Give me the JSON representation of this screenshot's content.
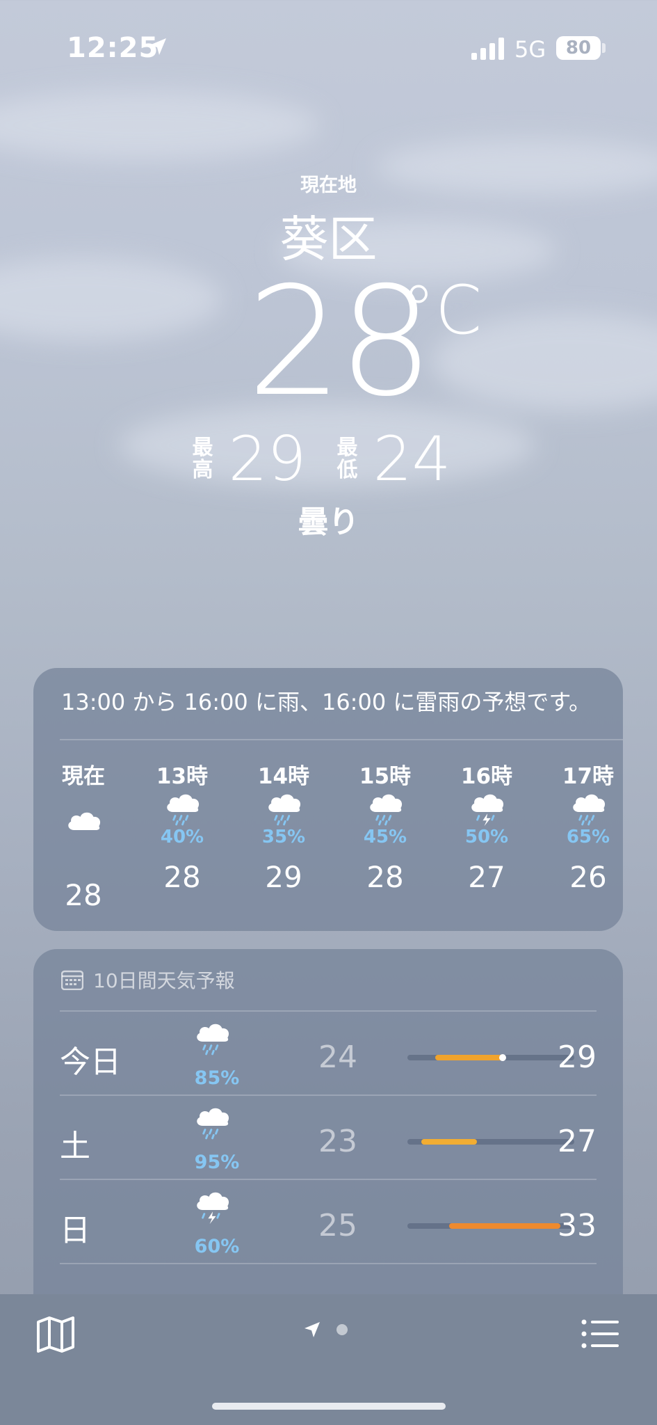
{
  "status_bar": {
    "time": "12:25",
    "network": "5G",
    "battery": "80"
  },
  "header": {
    "location_label": "現在地",
    "city": "葵区",
    "temperature": "28",
    "unit": "°C",
    "high_label": "最高",
    "high": "29",
    "low_label": "最低",
    "low": "24",
    "condition": "曇り"
  },
  "hourly": {
    "summary": "13:00 から 16:00 に雨、16:00 に雷雨の予想です。",
    "items": [
      {
        "label": "現在",
        "icon": "cloud-icon",
        "pct": "",
        "temp": "28"
      },
      {
        "label": "13時",
        "icon": "cloud-rain-icon",
        "pct": "40%",
        "temp": "28"
      },
      {
        "label": "14時",
        "icon": "cloud-rain-icon",
        "pct": "35%",
        "temp": "29"
      },
      {
        "label": "15時",
        "icon": "cloud-rain-icon",
        "pct": "45%",
        "temp": "28"
      },
      {
        "label": "16時",
        "icon": "cloud-thunder-icon",
        "pct": "50%",
        "temp": "27"
      },
      {
        "label": "17時",
        "icon": "cloud-rain-icon",
        "pct": "65%",
        "temp": "26"
      }
    ]
  },
  "daily": {
    "title": "10日間天気予報",
    "range_min": 22,
    "range_max": 34,
    "days": [
      {
        "name": "今日",
        "icon": "cloud-rain-icon",
        "pct": "85%",
        "low": "24",
        "high": "29",
        "bar_color": "#f0a32c",
        "current": 28
      },
      {
        "name": "土",
        "icon": "cloud-rain-icon",
        "pct": "95%",
        "low": "23",
        "high": "27",
        "bar_color": "#f2ad33",
        "current": null
      },
      {
        "name": "日",
        "icon": "cloud-thunder-icon",
        "pct": "60%",
        "low": "25",
        "high": "33",
        "bar_color": "#ee8a2e",
        "current": null
      }
    ]
  },
  "tabbar": {
    "map_icon": "map-icon",
    "location_icon": "location-arrow-icon",
    "list_icon": "list-icon"
  },
  "colors": {
    "precip": "#86c6f2",
    "card_bg": "#748298"
  }
}
